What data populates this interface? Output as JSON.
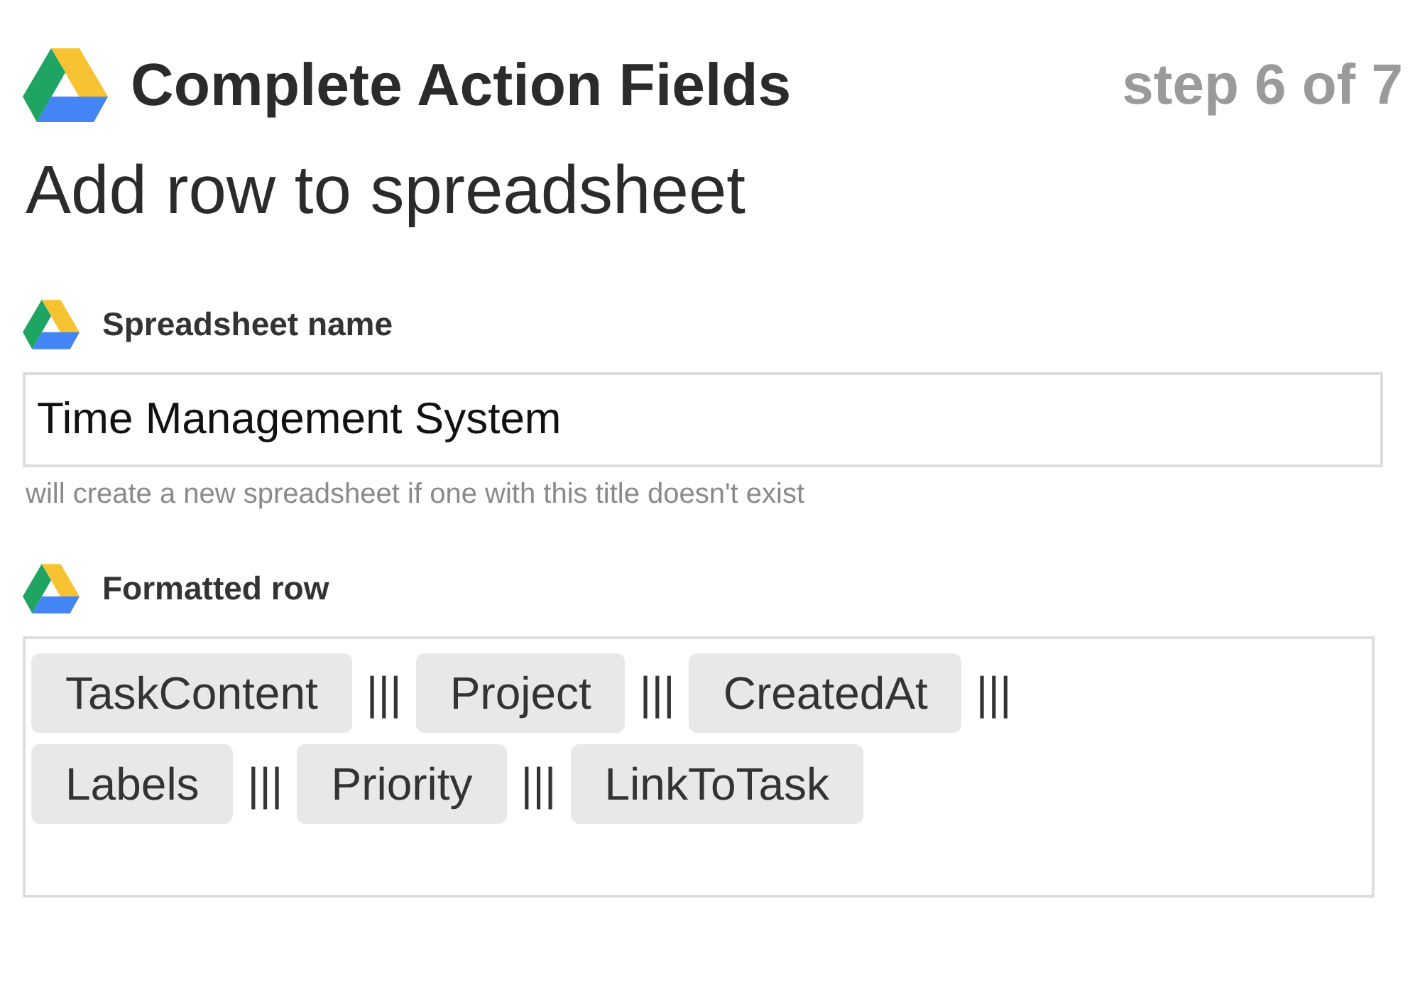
{
  "header": {
    "title": "Complete Action Fields",
    "step": "step 6 of 7"
  },
  "action_title": "Add row to spreadsheet",
  "fields": [
    {
      "kind": "text",
      "label": "Spreadsheet name",
      "value": "Time Management System",
      "hint": "will create a new spreadsheet if one with this title doesn't exist"
    },
    {
      "kind": "tokens",
      "label": "Formatted row",
      "items": [
        {
          "kind": "token",
          "text": "TaskContent"
        },
        {
          "kind": "separator",
          "text": "|||"
        },
        {
          "kind": "token",
          "text": "Project"
        },
        {
          "kind": "separator",
          "text": "|||"
        },
        {
          "kind": "token",
          "text": "CreatedAt"
        },
        {
          "kind": "separator",
          "text": "|||"
        },
        {
          "kind": "token",
          "text": "Labels"
        },
        {
          "kind": "separator",
          "text": "|||"
        },
        {
          "kind": "token",
          "text": "Priority"
        },
        {
          "kind": "separator",
          "text": "|||"
        },
        {
          "kind": "token",
          "text": "LinkToTask"
        }
      ]
    }
  ]
}
